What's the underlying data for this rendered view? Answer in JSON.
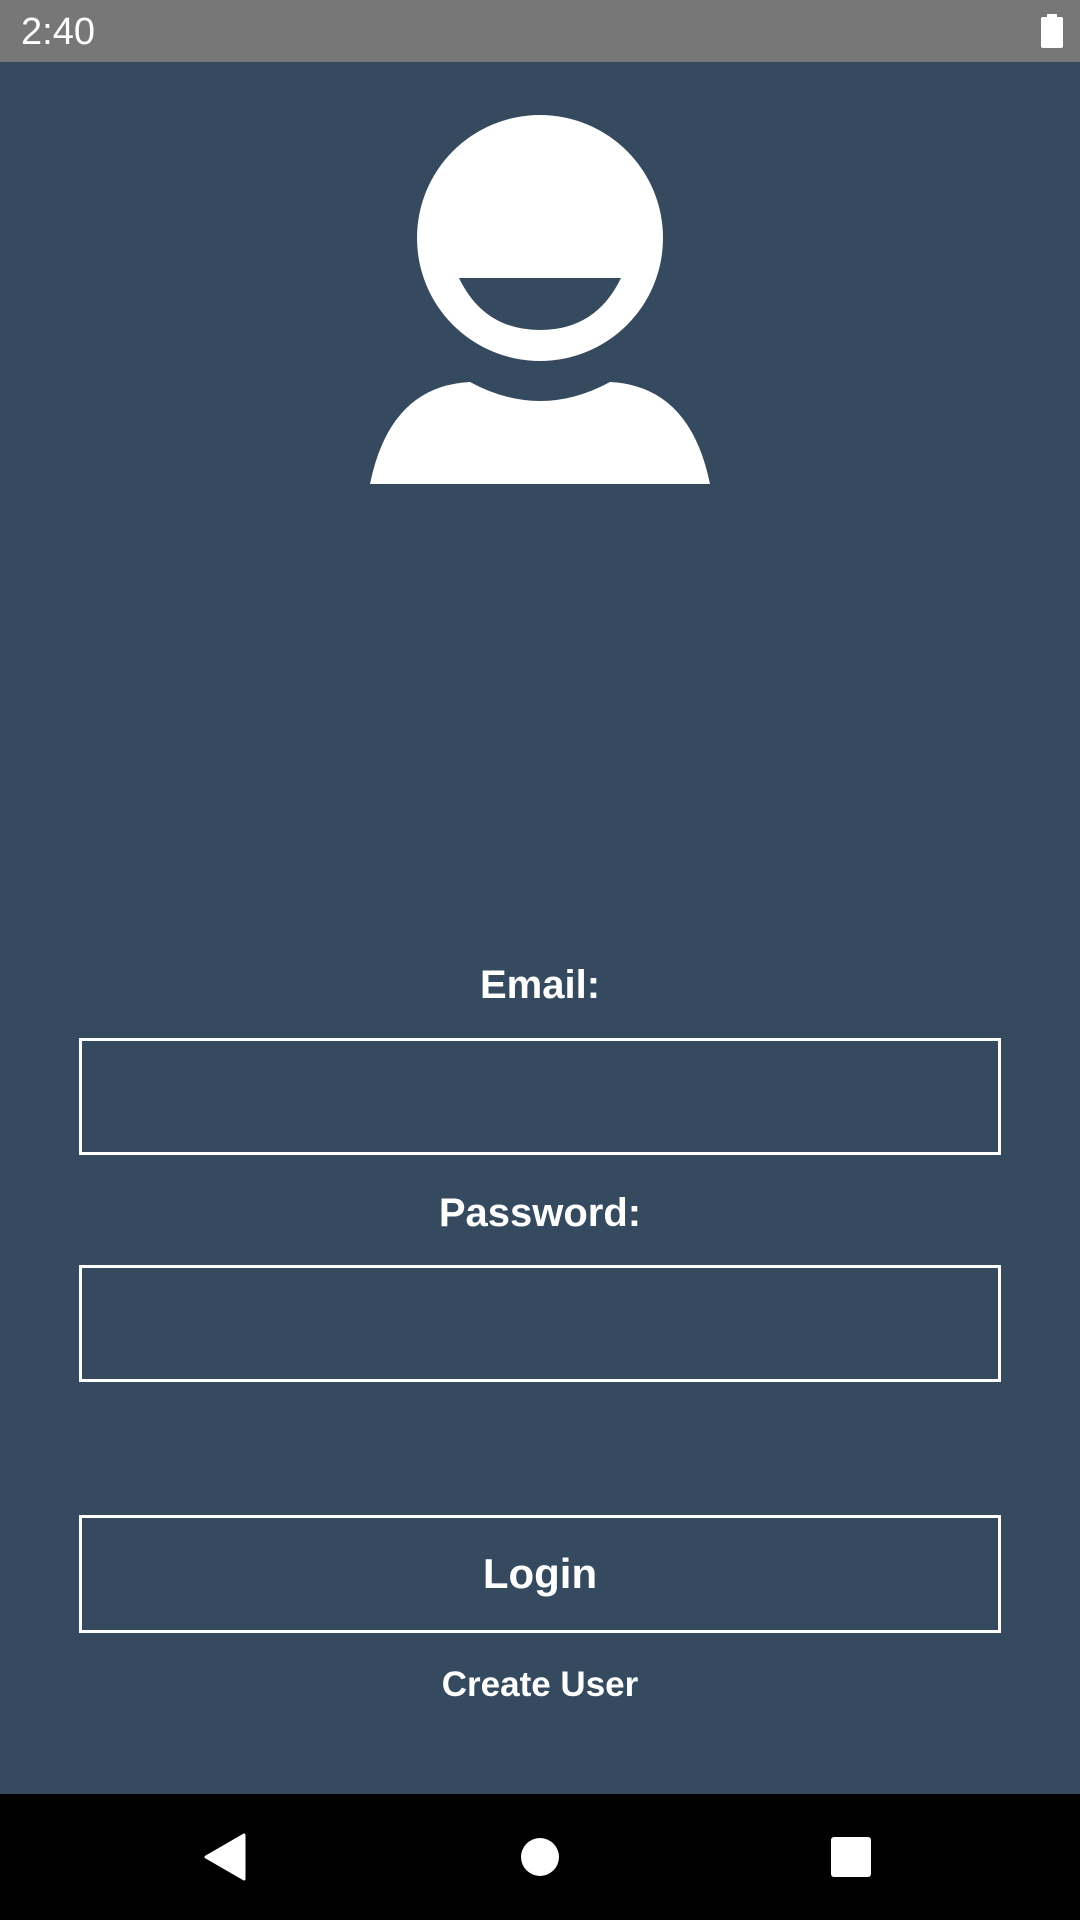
{
  "status_bar": {
    "time": "2:40",
    "battery_icon": "battery-full-icon"
  },
  "avatar": {
    "icon": "user-avatar-icon"
  },
  "login_form": {
    "email_label": "Email:",
    "email_value": "",
    "password_label": "Password:",
    "password_value": "",
    "login_button_label": "Login",
    "create_user_label": "Create User"
  },
  "nav_bar": {
    "back_icon": "back-triangle-icon",
    "home_icon": "home-circle-icon",
    "recents_icon": "recents-square-icon"
  },
  "colors": {
    "background": "#354a5f",
    "status_bar": "#777777",
    "nav_bar": "#000000",
    "foreground": "#ffffff"
  }
}
